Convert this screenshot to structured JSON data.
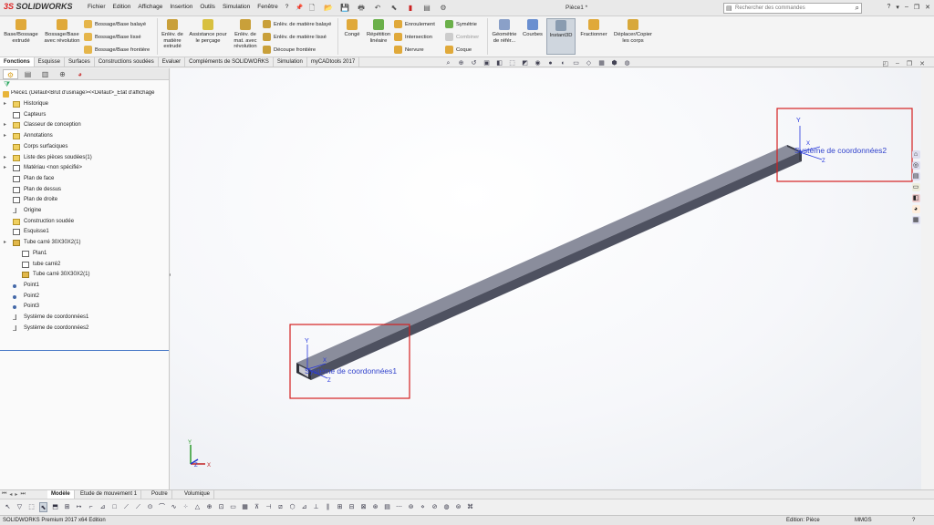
{
  "app": {
    "brand_left": "3S",
    "brand_name": "SOLIDWORKS",
    "doc_title": "Pièce1 *"
  },
  "menu": [
    "Fichier",
    "Edition",
    "Affichage",
    "Insertion",
    "Outils",
    "Simulation",
    "Fenêtre",
    "?"
  ],
  "search": {
    "placeholder": "Rechercher des commandes"
  },
  "ribbon": {
    "big": [
      "Base/Bossage extrudé",
      "Bossage/Base avec révolution",
      "Enlèv. de matière extrudé",
      "Assistance pour le perçage",
      "Enlèv. de mat. avec révolution",
      "Congé",
      "Répétition linéaire",
      "Géométrie de référ...",
      "Courbes",
      "Instant3D",
      "Fractionner",
      "Déplacer/Copier les corps"
    ],
    "small": [
      "Bossage/Base balayé",
      "Bossage/Base lissé",
      "Bossage/Base frontière",
      "Enlèv. de matière balayé",
      "Enlèv. de matière lissé",
      "Découpe frontière",
      "Enroulement",
      "Intersection",
      "Nervure",
      "Symétrie",
      "Combiner",
      "Coque"
    ]
  },
  "command_tabs": [
    "Fonctions",
    "Esquisse",
    "Surfaces",
    "Constructions soudées",
    "Evaluer",
    "Compléments de SOLIDWORKS",
    "Simulation",
    "myCADtools 2017"
  ],
  "tree": {
    "root": "Pièce1  (Défaut<Brut d'usinage><<Défaut>_Etat d'affichage",
    "items": [
      "Historique",
      "Capteurs",
      "Classeur de conception",
      "Annotations",
      "Corps surfaciques",
      "Liste des pièces soudées(1)",
      "Matériau <non spécifié>",
      "Plan de face",
      "Plan de dessus",
      "Plan de droite",
      "Origine",
      "Construction soudée",
      "Esquisse1",
      "Tube carré 30X30X2(1)",
      "Plan1",
      "tube carré2",
      "Tube carré 30X30X2(1)",
      "Point1",
      "Point2",
      "Point3",
      "Système de coordonnées1",
      "Système de coordonnées2"
    ]
  },
  "viewport": {
    "cs1_label": "Système de coordonnées1",
    "cs2_label": "Système de coordonnées2",
    "axis_y": "Y",
    "axis_x": "X",
    "axis_z": "Z",
    "colors": {
      "beam": "#5c5f6e",
      "highlight_box": "#d42020",
      "cs_label": "#3344cc"
    }
  },
  "bottom_tabs": [
    "Modèle",
    "Etude de mouvement 1",
    "Poutre",
    "Volumique"
  ],
  "status": {
    "edition": "SOLIDWORKS Premium 2017 x64 Edition",
    "mode": "Edition: Pièce",
    "units": "MMGS",
    "help": "?"
  }
}
